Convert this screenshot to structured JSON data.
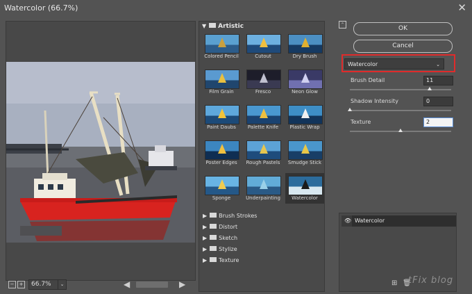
{
  "window": {
    "title": "Watercolor (66.7%)",
    "close": "✕"
  },
  "preview": {
    "zoom": "66.7%",
    "zoom_dropdown": "⌄",
    "left_arrow": "◀",
    "right_arrow": "▶",
    "btn_minus": "−",
    "btn_plus": "+"
  },
  "gallery": {
    "open_category": "Artistic",
    "filters": [
      "Colored Pencil",
      "Cutout",
      "Dry Brush",
      "Film Grain",
      "Fresco",
      "Neon Glow",
      "Paint Daubs",
      "Palette Knife",
      "Plastic Wrap",
      "Poster Edges",
      "Rough Pastels",
      "Smudge Stick",
      "Sponge",
      "Underpainting",
      "Watercolor"
    ],
    "selected_filter": "Watercolor",
    "categories": [
      "Brush Strokes",
      "Distort",
      "Sketch",
      "Stylize",
      "Texture"
    ]
  },
  "controls": {
    "ok_label": "OK",
    "cancel_label": "Cancel",
    "collapse_icon": "⌃",
    "filter_select": "Watercolor",
    "dropdown_icon": "⌄",
    "highlight_color": "#e02b2b",
    "params": [
      {
        "label": "Brush Detail",
        "value": "11",
        "level": 0.79
      },
      {
        "label": "Shadow Intensity",
        "value": "0",
        "level": 0.0
      },
      {
        "label": "Texture",
        "value": "2",
        "level": 0.5
      }
    ]
  },
  "layers": {
    "visible_icon": "👁",
    "items": [
      "Watercolor"
    ]
  },
  "footer": {
    "new_layer_icon": "⊞",
    "delete_icon": "🗑",
    "watermark": "tFix blog"
  }
}
